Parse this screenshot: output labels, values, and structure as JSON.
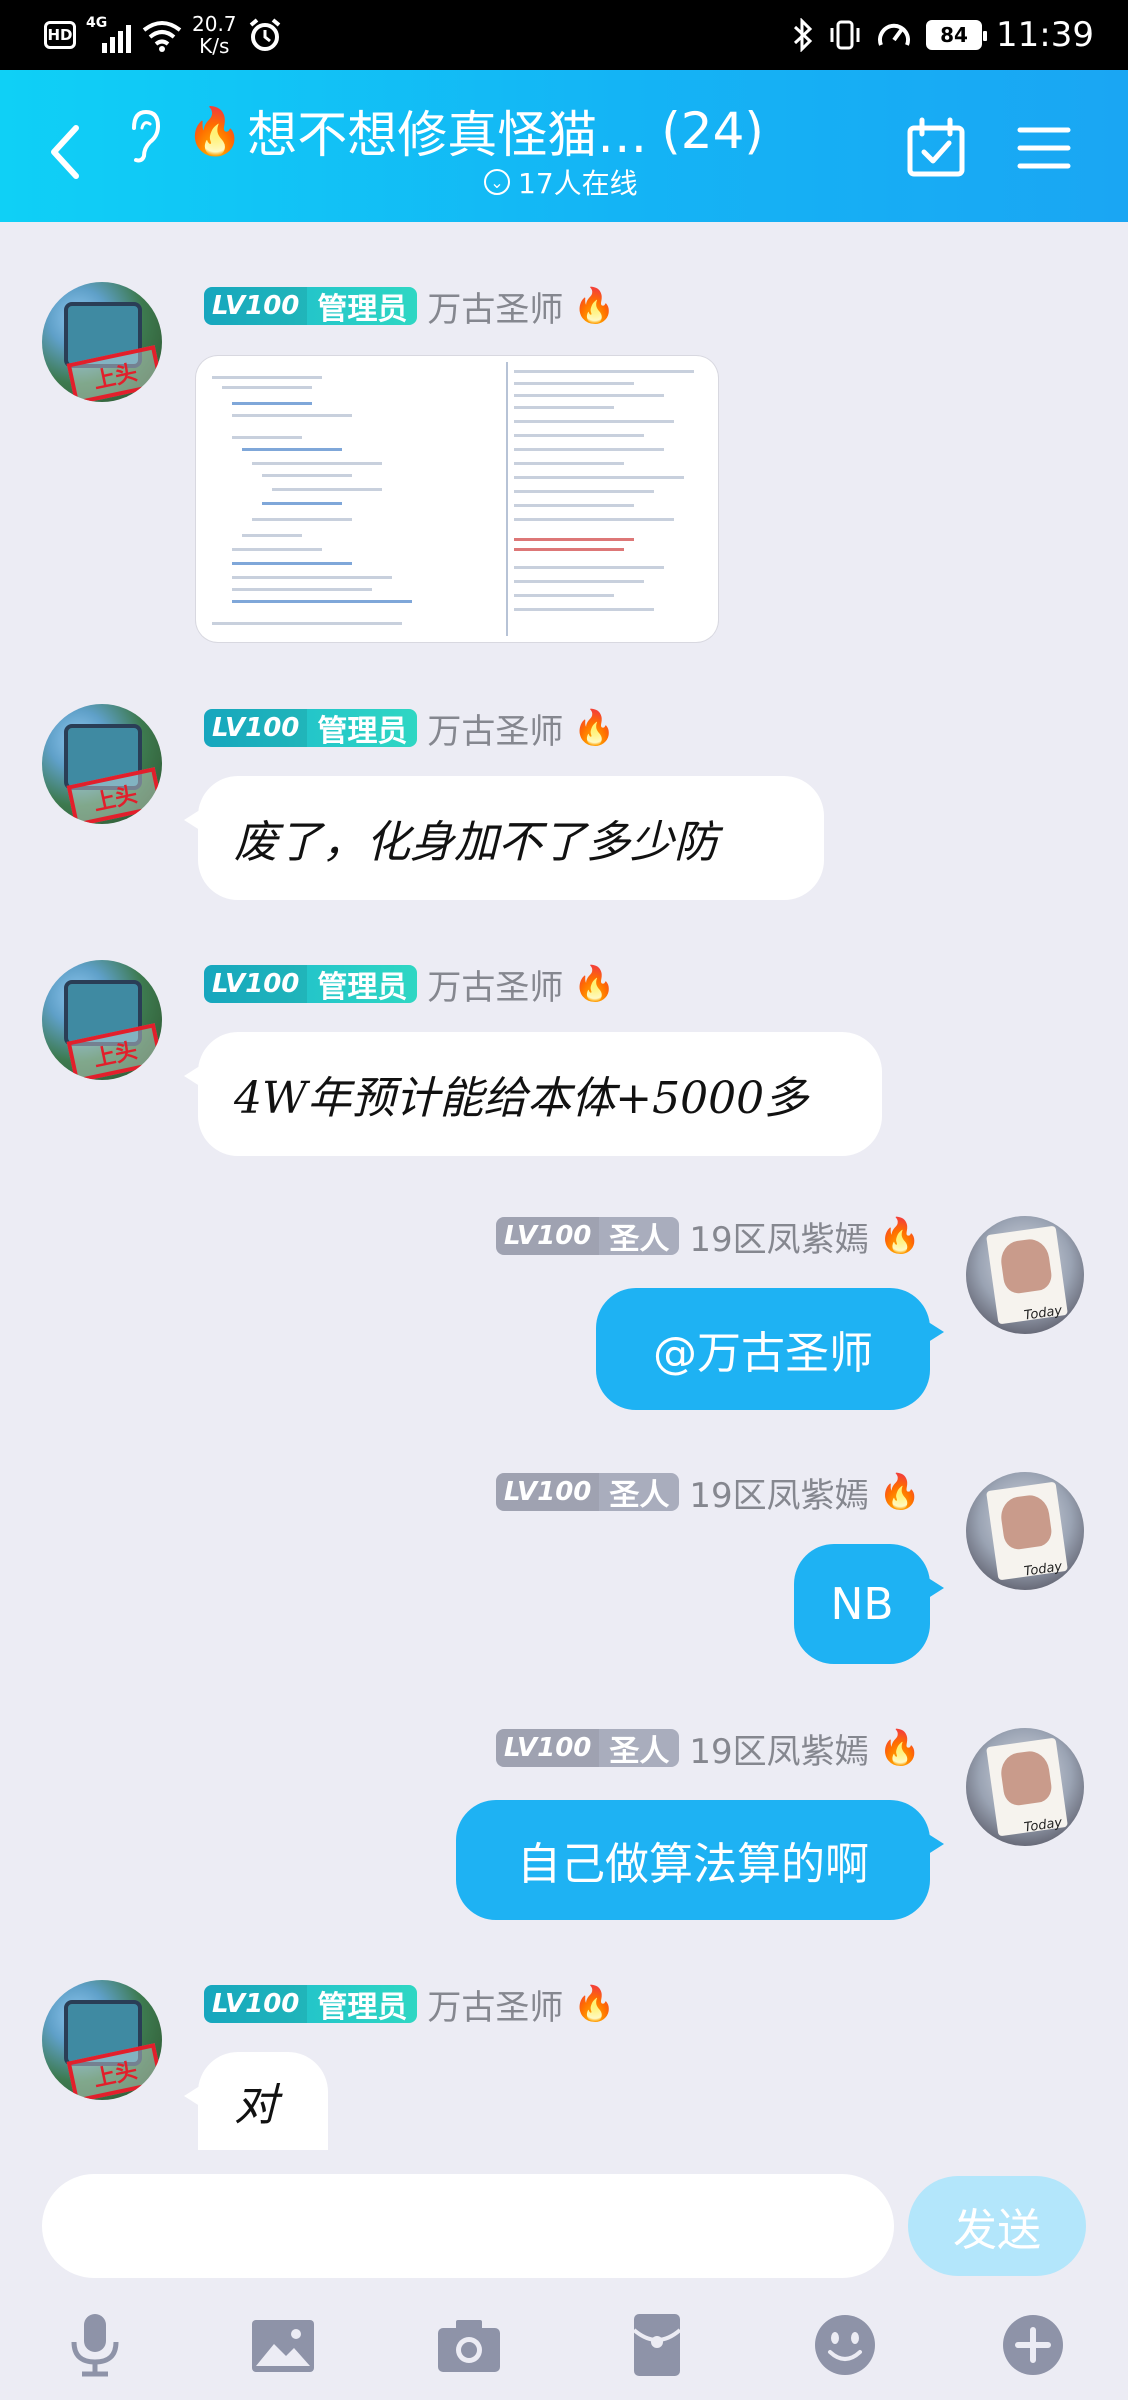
{
  "status_bar": {
    "hd": "HD",
    "network": "4G",
    "speed_value": "20.7",
    "speed_unit": "K/s",
    "battery": "84",
    "time": "11:39"
  },
  "header": {
    "title": "想不想修真怪猫…",
    "count": "(24)",
    "online": "17人在线"
  },
  "messages": [
    {
      "sender": "万古圣师",
      "level": "LV100",
      "role": "管理员",
      "type": "image",
      "avatar_stamp": "上头"
    },
    {
      "sender": "万古圣师",
      "level": "LV100",
      "role": "管理员",
      "type": "text",
      "text": "废了，化身加不了多少防",
      "avatar_stamp": "上头"
    },
    {
      "sender": "万古圣师",
      "level": "LV100",
      "role": "管理员",
      "type": "text",
      "text": "4W年预计能给本体+5000多",
      "avatar_stamp": "上头"
    },
    {
      "sender": "19区凤紫嫣",
      "level": "LV100",
      "role": "圣人",
      "type": "text",
      "text": "@万古圣师",
      "avatar_text": "Today"
    },
    {
      "sender": "19区凤紫嫣",
      "level": "LV100",
      "role": "圣人",
      "type": "text",
      "text": "NB",
      "avatar_text": "Today"
    },
    {
      "sender": "19区凤紫嫣",
      "level": "LV100",
      "role": "圣人",
      "type": "text",
      "text": "自己做算法算的啊",
      "avatar_text": "Today"
    },
    {
      "sender": "万古圣师",
      "level": "LV100",
      "role": "管理员",
      "type": "text",
      "text": "对",
      "avatar_stamp": "上头"
    }
  ],
  "composer": {
    "placeholder": "",
    "send_label": "发送"
  },
  "toolbar": [
    "mic-icon",
    "image-icon",
    "camera-icon",
    "red-packet-icon",
    "emoji-icon",
    "plus-icon"
  ],
  "colors": {
    "header_start": "#0fd0f6",
    "header_end": "#1aa6f3",
    "bubble_self": "#1eb2f3",
    "admin_tag": "#19b5cf",
    "saint_tag": "#a9adbd",
    "send_disabled": "#b3e6fb",
    "background": "#ececf4"
  }
}
